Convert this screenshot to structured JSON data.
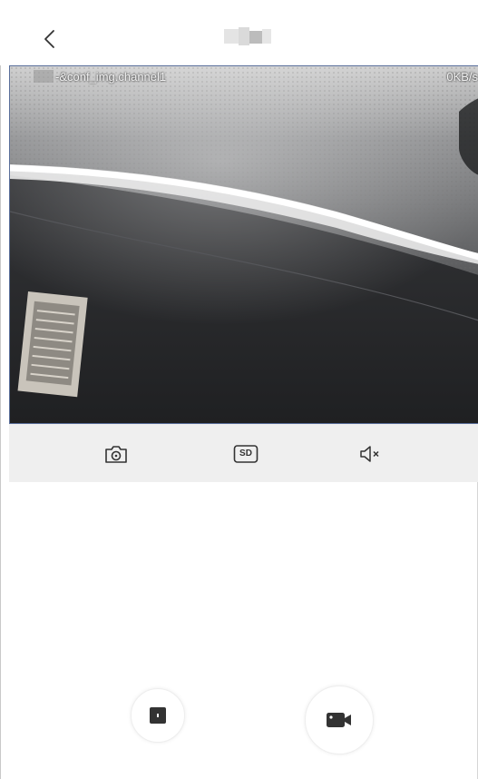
{
  "header": {
    "back_icon": "chevron-left-icon",
    "title": ""
  },
  "video": {
    "channel_label": "-&conf_img.channel1",
    "rate": "0KB/s"
  },
  "toolbar": {
    "items": [
      {
        "icon": "camera-snapshot-icon"
      },
      {
        "icon": "sd-quality-icon",
        "label": "SD"
      },
      {
        "icon": "speaker-muted-icon"
      }
    ]
  },
  "controls": {
    "left_icon": "intercom-square-icon",
    "right_icon": "video-record-icon"
  },
  "colors": {
    "toolbar_bg": "#efefef",
    "icon_dark": "#333333",
    "video_border": "#5a6f9b"
  }
}
